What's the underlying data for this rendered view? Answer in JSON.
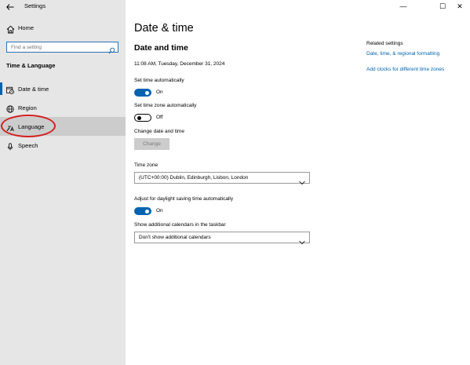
{
  "window": {
    "app_title": "Settings",
    "back_icon": "back-arrow-icon",
    "controls": {
      "minimize": "—",
      "maximize": "☐",
      "close": "✕"
    }
  },
  "sidebar": {
    "home_label": "Home",
    "search_placeholder": "Find a setting",
    "section_heading": "Time & Language",
    "items": [
      {
        "label": "Date & time",
        "icon": "calendar-clock-icon",
        "active": true
      },
      {
        "label": "Region",
        "icon": "globe-icon",
        "active": false
      },
      {
        "label": "Language",
        "icon": "language-icon",
        "active": false
      },
      {
        "label": "Speech",
        "icon": "microphone-icon",
        "active": false
      }
    ]
  },
  "main": {
    "page_title": "Date & time",
    "section_title": "Date and time",
    "current_datetime": "11:08 AM, Tuesday, December 31, 2024",
    "set_time_auto": {
      "label": "Set time automatically",
      "state": "On"
    },
    "set_timezone_auto": {
      "label": "Set time zone automatically",
      "state": "Off"
    },
    "change_datetime": {
      "label": "Change date and time",
      "button": "Change"
    },
    "time_zone": {
      "label": "Time zone",
      "value": "(UTC+00:00) Dublin, Edinburgh, Lisbon, London"
    },
    "daylight_saving": {
      "label": "Adjust for daylight saving time automatically",
      "state": "On"
    },
    "additional_calendars": {
      "label": "Show additional calendars in the taskbar",
      "value": "Don't show additional calendars"
    }
  },
  "related": {
    "heading": "Related settings",
    "links": [
      "Date, time, & regional formatting",
      "Add clocks for different time zones"
    ]
  },
  "colors": {
    "accent": "#0063b1",
    "sidebar_bg": "#e6e6e6",
    "annotation": "#d21f1f"
  }
}
